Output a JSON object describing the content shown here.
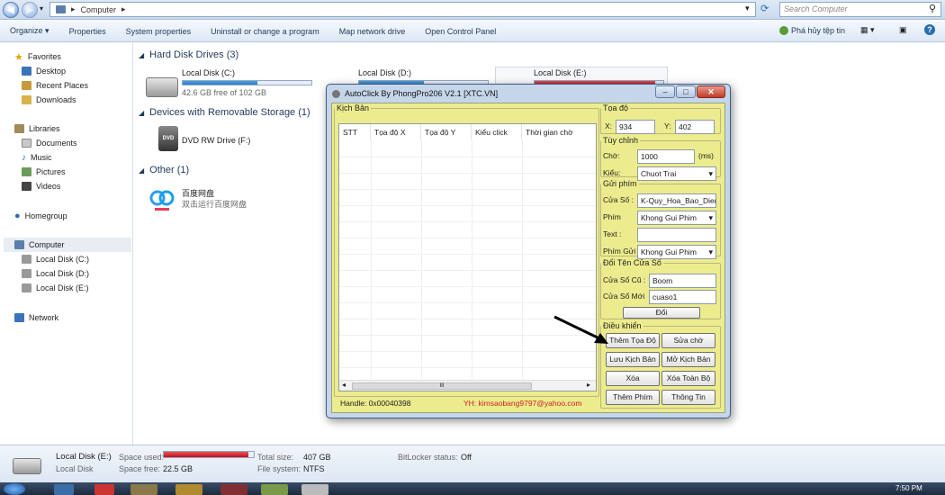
{
  "address": {
    "path": "Computer",
    "search_placeholder": "Search Computer"
  },
  "toolbar": {
    "organize": "Organize",
    "system_properties": "Properties",
    "sys_props": "System properties",
    "uninstall": "Uninstall or change a program",
    "map_drive": "Map network drive",
    "control_panel": "Open Control Panel",
    "right_tool": "Phá hủy tệp tin"
  },
  "nav": {
    "favorites": "Favorites",
    "desktop": "Desktop",
    "recent": "Recent Places",
    "downloads": "Downloads",
    "libraries": "Libraries",
    "documents": "Documents",
    "music": "Music",
    "pictures": "Pictures",
    "videos": "Videos",
    "homegroup": "Homegroup",
    "computer": "Computer",
    "disk_c": "Local Disk (C:)",
    "disk_d": "Local Disk (D:)",
    "disk_e": "Local Disk (E:)",
    "network": "Network"
  },
  "content": {
    "hdd_group": "Hard Disk Drives (3)",
    "removable_group": "Devices with Removable Storage (1)",
    "other_group": "Other (1)",
    "drive_c": {
      "name": "Local Disk (C:)",
      "free": "42.6 GB free of 102 GB",
      "used_fraction": 0.58
    },
    "drive_d": {
      "name": "Local Disk (D:)",
      "used_fraction": 0.5
    },
    "drive_e": {
      "name": "Local Disk (E:)",
      "used_fraction": 0.94
    },
    "dvd": {
      "name": "DVD RW Drive (F:)",
      "label": "DVD"
    },
    "baidu": {
      "name": "百度网盘",
      "sub": "双击运行百度网盘"
    }
  },
  "status": {
    "drive_name": "Local Disk (E:)",
    "drive_type": "Local Disk",
    "space_used_label": "Space used:",
    "space_free_label": "Space free:",
    "space_free": "22.5 GB",
    "total_size_label": "Total size:",
    "total_size": "407 GB",
    "fs_label": "File system:",
    "fs": "NTFS",
    "bitlocker_label": "BitLocker status:",
    "bitlocker": "Off",
    "used_fraction": 0.94,
    "clock": "7:50 PM"
  },
  "dialog": {
    "title": "AutoClick By PhongPro206 V2.1 [XTC.VN]",
    "script_group": "Kịch Bản",
    "columns": [
      "STT",
      "Tọa độ X",
      "Tọa độ Y",
      "Kiểu click",
      "Thời gian chờ"
    ],
    "handle": "Handle: 0x00040398",
    "contact": "YH: kimsaobang9797@yahoo.com",
    "coord": {
      "legend": "Tọa độ",
      "x_label": "X:",
      "x": "934",
      "y_label": "Y:",
      "y": "402"
    },
    "custom": {
      "legend": "Tùy chỉnh",
      "wait_label": "Chờ:",
      "wait": "1000",
      "unit": "(ms)",
      "type_label": "Kiểu:",
      "type": "Chuot Trai"
    },
    "keys": {
      "legend": "Gửi phím",
      "window_label": "Cửa Số :",
      "window": "K-Quy_Hoa_Bao_Dien",
      "key_label": "Phím",
      "key": "Khong Gui Phim",
      "text_label": "Text :",
      "text": "",
      "send_key_label": "Phím Gửi :",
      "send_key": "Khong Gui Phim"
    },
    "rename": {
      "legend": "Đổi Tên Cửa Số",
      "old_label": "Cửa Sổ Cũ :",
      "old": "Boom",
      "new_label": "Cửa Sổ Mới",
      "new": "cuaso1",
      "button": "Đổi"
    },
    "control": {
      "legend": "Điều khiển",
      "add_coord": "Thêm Tọa Độ",
      "edit_wait": "Sửa chờ",
      "save_script": "Lưu Kịch Bản",
      "open_script": "Mở Kịch Bản",
      "delete": "Xóa",
      "delete_all": "Xóa Toàn Bộ",
      "add_key": "Thêm Phím",
      "info": "Thông Tin"
    },
    "scroll_mark": "III"
  }
}
